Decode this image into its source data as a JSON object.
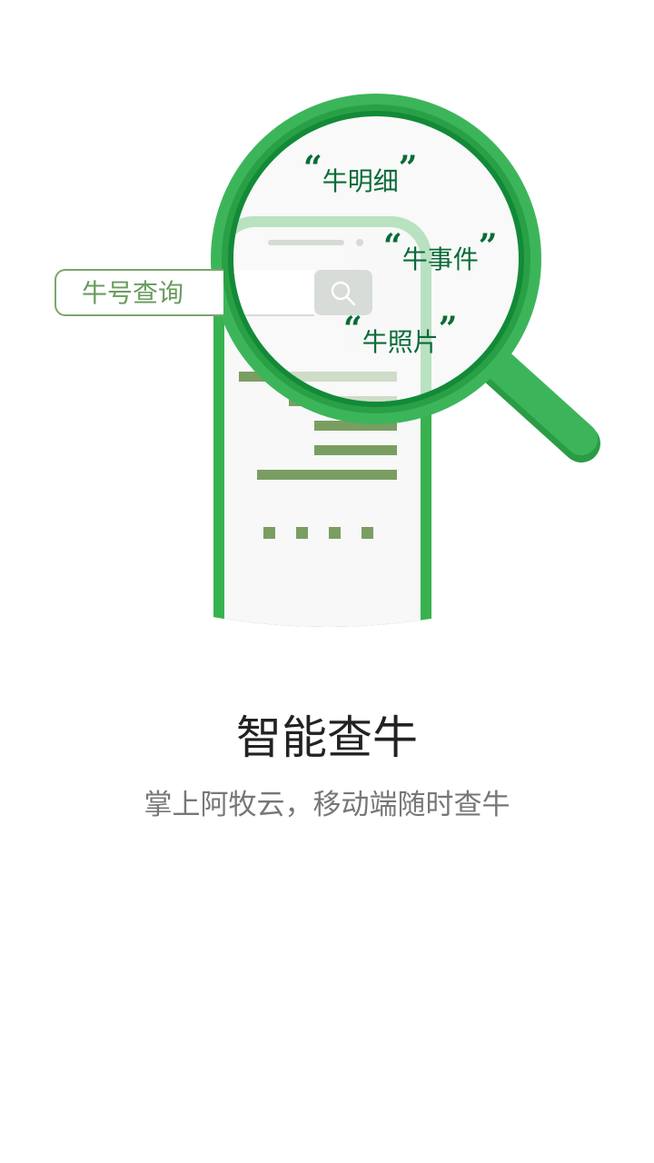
{
  "illustration": {
    "search_placeholder": "牛号查询",
    "labels": [
      "牛明细",
      "牛事件",
      "牛照片"
    ],
    "open_quote": "“",
    "close_quote": "”"
  },
  "intro": {
    "title": "智能查牛",
    "subtitle": "掌上阿牧云，移动端随时查牛"
  },
  "colors": {
    "brand_green": "#3cb55a",
    "dark_green": "#0b6b38",
    "olive_line": "#7a9e62",
    "search_border": "#7ba56a"
  },
  "icons": [
    "search-icon",
    "magnifier-illustration",
    "phone-illustration"
  ]
}
